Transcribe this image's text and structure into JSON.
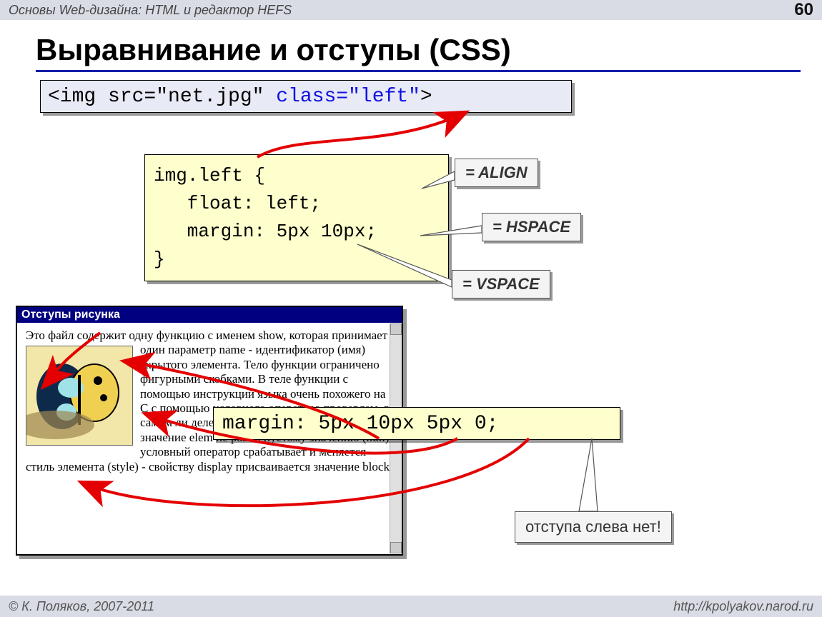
{
  "header": {
    "course": "Основы Web-дизайна: HTML и редактор HEFS",
    "page_number": "60"
  },
  "title": "Выравнивание и отступы (CSS)",
  "code1": {
    "prefix": "<img src=\"net.jpg\" ",
    "class_part": "class=\"left\"",
    "suffix": ">"
  },
  "code2": {
    "line1": "img.left {",
    "line2": "   float: left;",
    "line3": "   margin: 5px 10px;",
    "line4": "}"
  },
  "tags": {
    "align": "= ALIGN",
    "hspace": "= HSPACE",
    "vspace": "= VSPACE"
  },
  "browser": {
    "title": "Отступы рисунка",
    "paragraph": "Это файл содержит одну функцию с именем show, которая принимает один параметр name - идентификатор (имя) скрытого элемента. Тело функции ограничено фигурными скобками. В теле функции с помощью инструкций языка очень похожего на С с помощью условного оператора проверяем, в самом ли деле такой элемент найден. Если значение elem не равно пустому значению (null), условный оператор срабатывает и меняется стиль элемента (style) - свойству display присваивается значение block."
  },
  "code3": "margin: 5px 10px 5px 0;",
  "callout": "отступа слева нет!",
  "footer": {
    "copyright": "© К. Поляков, 2007-2011",
    "url": "http://kpolyakov.narod.ru"
  }
}
